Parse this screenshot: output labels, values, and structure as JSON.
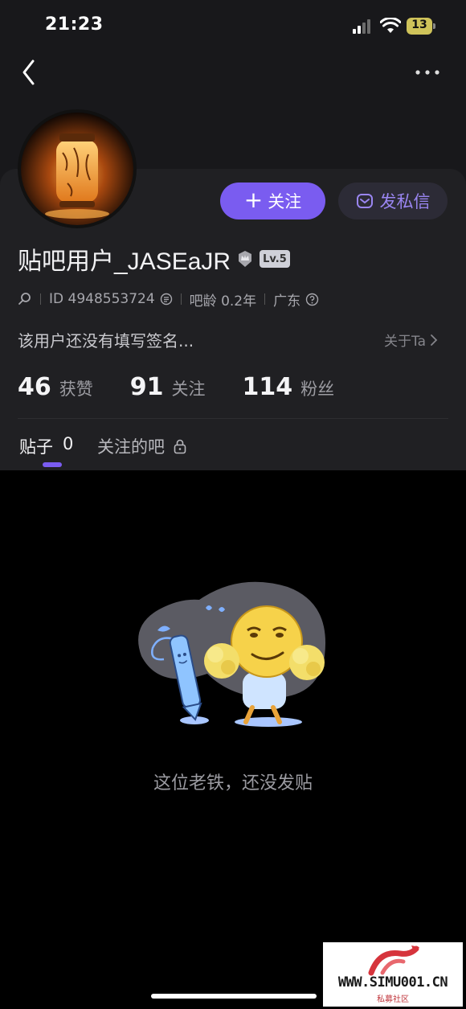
{
  "status_bar": {
    "time": "21:23",
    "battery": "13"
  },
  "profile": {
    "username": "贴吧用户_JASEaJR",
    "level_badge": "Lv.5",
    "user_id": "ID 4948553724",
    "account_age": "吧龄 0.2年",
    "location": "广东",
    "bio": "该用户还没有填写签名...",
    "about_link": "关于Ta"
  },
  "actions": {
    "follow_label": "关注",
    "message_label": "发私信"
  },
  "stats": [
    {
      "value": "46",
      "label": "获赞"
    },
    {
      "value": "91",
      "label": "关注"
    },
    {
      "value": "114",
      "label": "粉丝"
    }
  ],
  "tabs": {
    "posts_label": "贴子",
    "posts_count": "0",
    "followed_bars_label": "关注的吧"
  },
  "empty_state": {
    "message": "这位老铁，还没发贴"
  },
  "watermark": {
    "text": "WWW.SIMU001.CN",
    "subtext": "私募社区"
  },
  "colors": {
    "accent": "#7a5cf0",
    "background": "#000000",
    "card": "#202023"
  }
}
